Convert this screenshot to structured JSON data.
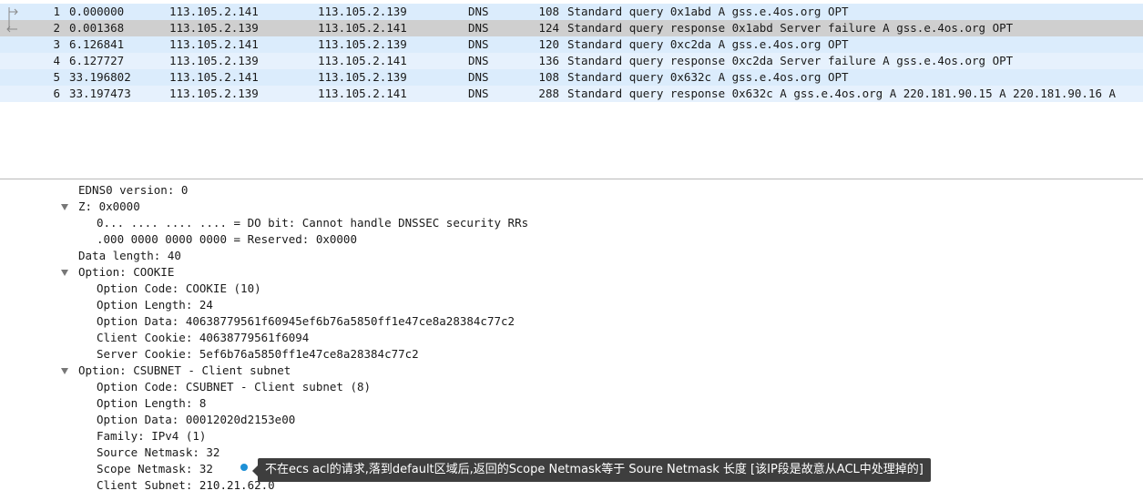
{
  "packets": [
    {
      "no": "1",
      "time": "0.000000",
      "src": "113.105.2.141",
      "dst": "113.105.2.139",
      "proto": "DNS",
      "len": "108",
      "info": "Standard query 0x1abd A gss.e.4os.org OPT"
    },
    {
      "no": "2",
      "time": "0.001368",
      "src": "113.105.2.139",
      "dst": "113.105.2.141",
      "proto": "DNS",
      "len": "124",
      "info": "Standard query response 0x1abd Server failure A gss.e.4os.org OPT"
    },
    {
      "no": "3",
      "time": "6.126841",
      "src": "113.105.2.141",
      "dst": "113.105.2.139",
      "proto": "DNS",
      "len": "120",
      "info": "Standard query 0xc2da A gss.e.4os.org OPT"
    },
    {
      "no": "4",
      "time": "6.127727",
      "src": "113.105.2.139",
      "dst": "113.105.2.141",
      "proto": "DNS",
      "len": "136",
      "info": "Standard query response 0xc2da Server failure A gss.e.4os.org OPT"
    },
    {
      "no": "5",
      "time": "33.196802",
      "src": "113.105.2.141",
      "dst": "113.105.2.139",
      "proto": "DNS",
      "len": "108",
      "info": "Standard query 0x632c A gss.e.4os.org OPT"
    },
    {
      "no": "6",
      "time": "33.197473",
      "src": "113.105.2.139",
      "dst": "113.105.2.141",
      "proto": "DNS",
      "len": "288",
      "info": "Standard query response 0x632c A gss.e.4os.org A 220.181.90.15 A 220.181.90.16 A"
    }
  ],
  "details": [
    {
      "indent": 1,
      "text": "EDNS0 version: 0"
    },
    {
      "indent": 1,
      "expander": true,
      "text": "Z: 0x0000"
    },
    {
      "indent": 2,
      "text": "0... .... .... .... = DO bit: Cannot handle DNSSEC security RRs"
    },
    {
      "indent": 2,
      "text": ".000 0000 0000 0000 = Reserved: 0x0000"
    },
    {
      "indent": 1,
      "text": "Data length: 40"
    },
    {
      "indent": 1,
      "expander": true,
      "text": "Option: COOKIE"
    },
    {
      "indent": 2,
      "text": "Option Code: COOKIE (10)"
    },
    {
      "indent": 2,
      "text": "Option Length: 24"
    },
    {
      "indent": 2,
      "text": "Option Data: 40638779561f60945ef6b76a5850ff1e47ce8a28384c77c2"
    },
    {
      "indent": 2,
      "text": "Client Cookie: 40638779561f6094"
    },
    {
      "indent": 2,
      "text": "Server Cookie: 5ef6b76a5850ff1e47ce8a28384c77c2"
    },
    {
      "indent": 1,
      "expander": true,
      "text": "Option: CSUBNET - Client subnet"
    },
    {
      "indent": 2,
      "text": "Option Code: CSUBNET - Client subnet (8)"
    },
    {
      "indent": 2,
      "text": "Option Length: 8"
    },
    {
      "indent": 2,
      "text": "Option Data: 00012020d2153e00"
    },
    {
      "indent": 2,
      "text": "Family: IPv4 (1)"
    },
    {
      "indent": 2,
      "text": "Source Netmask: 32"
    },
    {
      "indent": 2,
      "text": "Scope Netmask: 32"
    },
    {
      "indent": 2,
      "text": "Client Subnet: 210.21.62.0"
    }
  ],
  "annotation": {
    "text": "不在ecs acl的请求,落到default区域后,返回的Scope Netmask等于 Soure Netmask 长度 [该IP段是故意从ACL中处理掉的]"
  },
  "colors": {
    "row_odd": "#dbecfc",
    "row_even": "#e6f1fd",
    "row_selected": "#cfcfcf",
    "tooltip_bg": "#3e3e3e",
    "dot": "#1e90d6"
  }
}
